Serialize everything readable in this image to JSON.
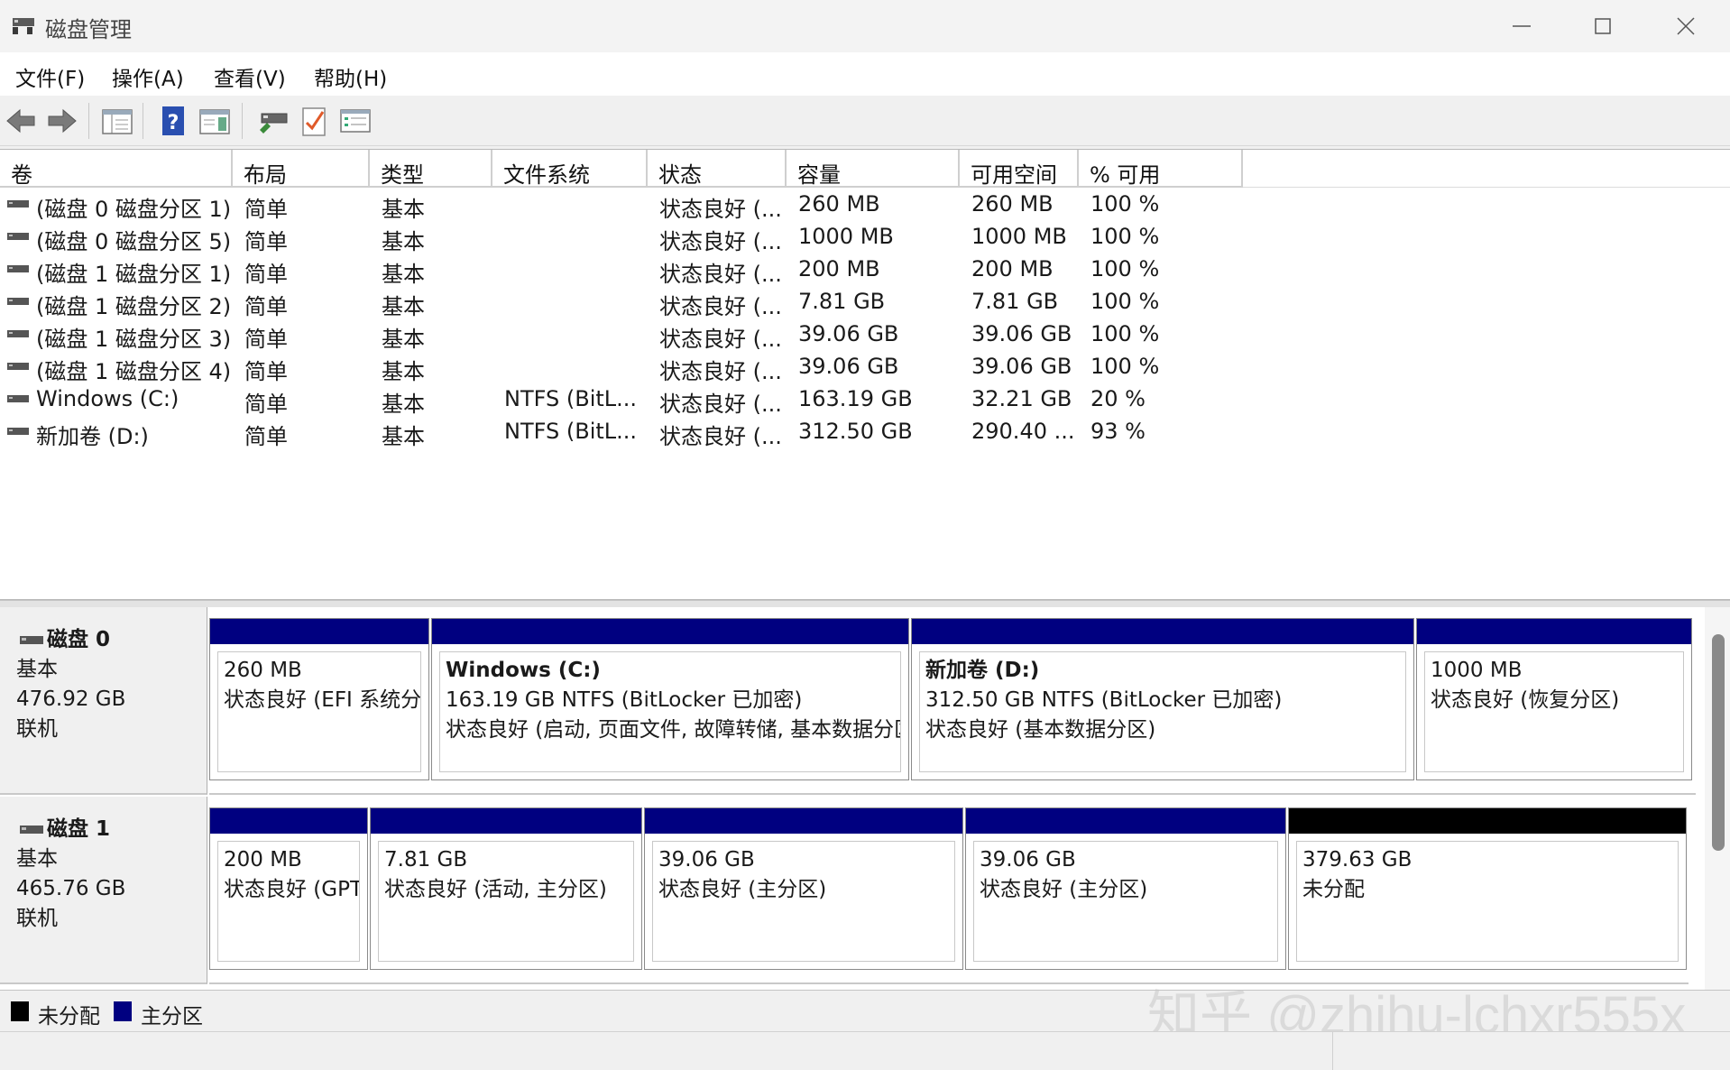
{
  "window": {
    "title": "磁盘管理"
  },
  "menu": {
    "items": [
      "文件(F)",
      "操作(A)",
      "查看(V)",
      "帮助(H)"
    ]
  },
  "toolbar": {
    "buttons": [
      "back-icon",
      "forward-icon",
      "show-hide-console-tree-icon",
      "help-icon",
      "properties-icon",
      "connect-drive-icon",
      "check-icon",
      "list-view-icon"
    ]
  },
  "volume_list": {
    "columns": [
      "卷",
      "布局",
      "类型",
      "文件系统",
      "状态",
      "容量",
      "可用空间",
      "% 可用"
    ],
    "rows": [
      [
        "(磁盘 0 磁盘分区 1)",
        "简单",
        "基本",
        "",
        "状态良好 (...",
        "260 MB",
        "260 MB",
        "100 %"
      ],
      [
        "(磁盘 0 磁盘分区 5)",
        "简单",
        "基本",
        "",
        "状态良好 (...",
        "1000 MB",
        "1000 MB",
        "100 %"
      ],
      [
        "(磁盘 1 磁盘分区 1)",
        "简单",
        "基本",
        "",
        "状态良好 (...",
        "200 MB",
        "200 MB",
        "100 %"
      ],
      [
        "(磁盘 1 磁盘分区 2)",
        "简单",
        "基本",
        "",
        "状态良好 (...",
        "7.81 GB",
        "7.81 GB",
        "100 %"
      ],
      [
        "(磁盘 1 磁盘分区 3)",
        "简单",
        "基本",
        "",
        "状态良好 (...",
        "39.06 GB",
        "39.06 GB",
        "100 %"
      ],
      [
        "(磁盘 1 磁盘分区 4)",
        "简单",
        "基本",
        "",
        "状态良好 (...",
        "39.06 GB",
        "39.06 GB",
        "100 %"
      ],
      [
        "Windows (C:)",
        "简单",
        "基本",
        "NTFS (BitL...",
        "状态良好 (...",
        "163.19 GB",
        "32.21 GB",
        "20 %"
      ],
      [
        "新加卷 (D:)",
        "简单",
        "基本",
        "NTFS (BitL...",
        "状态良好 (...",
        "312.50 GB",
        "290.40 ...",
        "93 %"
      ]
    ]
  },
  "disks": [
    {
      "name": "磁盘 0",
      "type": "基本",
      "size": "476.92 GB",
      "status": "联机",
      "partitions": [
        {
          "name": "",
          "line1": "260 MB",
          "line2": "状态良好 (EFI 系统分区)",
          "kind": "primary"
        },
        {
          "name": "Windows  (C:)",
          "line1": "163.19 GB NTFS (BitLocker 已加密)",
          "line2": "状态良好 (启动, 页面文件, 故障转储, 基本数据分区)",
          "kind": "primary"
        },
        {
          "name": "新加卷  (D:)",
          "line1": "312.50 GB NTFS (BitLocker 已加密)",
          "line2": "状态良好 (基本数据分区)",
          "kind": "primary"
        },
        {
          "name": "",
          "line1": "1000 MB",
          "line2": "状态良好 (恢复分区)",
          "kind": "primary"
        }
      ]
    },
    {
      "name": "磁盘 1",
      "type": "基本",
      "size": "465.76 GB",
      "status": "联机",
      "partitions": [
        {
          "name": "",
          "line1": "200 MB",
          "line2": "状态良好 (GPT",
          "kind": "primary"
        },
        {
          "name": "",
          "line1": "7.81 GB",
          "line2": "状态良好 (活动, 主分区)",
          "kind": "primary"
        },
        {
          "name": "",
          "line1": "39.06 GB",
          "line2": "状态良好 (主分区)",
          "kind": "primary"
        },
        {
          "name": "",
          "line1": "39.06 GB",
          "line2": "状态良好 (主分区)",
          "kind": "primary"
        },
        {
          "name": "",
          "line1": "379.63 GB",
          "line2": "未分配",
          "kind": "unallocated"
        }
      ]
    }
  ],
  "legend": {
    "items": [
      {
        "label": "未分配",
        "color": "#000000"
      },
      {
        "label": "主分区",
        "color": "#000080"
      }
    ]
  },
  "colors": {
    "primary_partition": "#000080",
    "unallocated": "#000000"
  },
  "watermark": "知乎 @zhihu-lchxr555x"
}
